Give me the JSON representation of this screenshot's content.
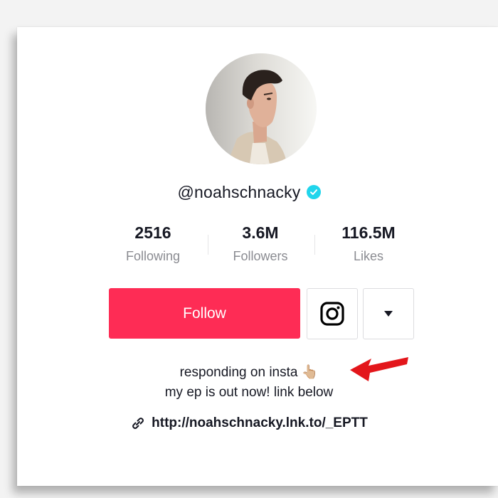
{
  "profile": {
    "username": "@noahschnacky",
    "verified": true
  },
  "stats": [
    {
      "value": "2516",
      "label": "Following"
    },
    {
      "value": "3.6M",
      "label": "Followers"
    },
    {
      "value": "116.5M",
      "label": "Likes"
    }
  ],
  "actions": {
    "follow_label": "Follow",
    "instagram_icon": "instagram-icon",
    "more_icon": "caret-down-icon"
  },
  "bio": {
    "line1": "responding on insta 👆🏼",
    "line2": "my ep is out now! link below"
  },
  "link": {
    "icon": "link-icon",
    "url": "http://noahschnacky.lnk.to/_EPTT"
  },
  "colors": {
    "follow": "#fe2c55",
    "verified": "#20d5ec",
    "annotation_arrow": "#e3161b"
  }
}
